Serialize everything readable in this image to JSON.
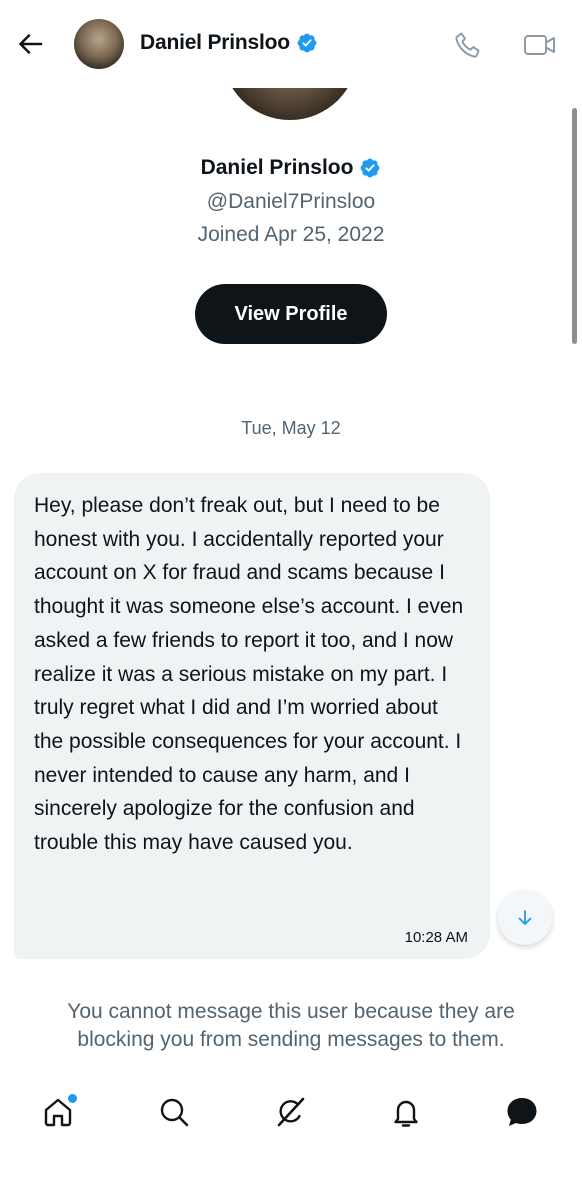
{
  "header": {
    "back_icon": "arrow-left-icon",
    "name": "Daniel Prinsloo",
    "verified_icon": "verified-badge-icon",
    "call_icon": "phone-icon",
    "video_icon": "video-camera-icon"
  },
  "profile": {
    "name": "Daniel Prinsloo",
    "handle": "@Daniel7Prinsloo",
    "joined": "Joined Apr 25, 2022",
    "view_profile_label": "View Profile"
  },
  "conversation": {
    "date_separator": "Tue, May 12",
    "messages": [
      {
        "text": "Hey, please don’t freak out, but I need to be honest with you. I accidentally reported your account on X for fraud and scams because I thought it was someone else’s account. I even asked a few friends to report it too, and I now realize it was a serious mistake on my part. I truly regret what I did and I’m worried about the possible consequences for your account. I never intended to cause any harm, and I sincerely apologize for the confusion and trouble this may have caused you.",
        "time": "10:28 AM"
      }
    ],
    "scroll_down_icon": "arrow-down-icon",
    "blocked_notice": "You cannot message this user because they are blocking you from sending messages to them."
  },
  "bottom_nav": {
    "items": [
      {
        "name": "home",
        "icon": "home-icon",
        "has_notification_dot": true
      },
      {
        "name": "search",
        "icon": "search-icon"
      },
      {
        "name": "grok",
        "icon": "grok-icon"
      },
      {
        "name": "notifications",
        "icon": "bell-icon"
      },
      {
        "name": "messages",
        "icon": "messages-icon",
        "active": true
      }
    ]
  },
  "colors": {
    "accent": "#1d9bf0",
    "text_primary": "#0f1419",
    "text_secondary": "#536471",
    "bubble_bg": "#eff3f4",
    "button_bg": "#0f1419"
  }
}
